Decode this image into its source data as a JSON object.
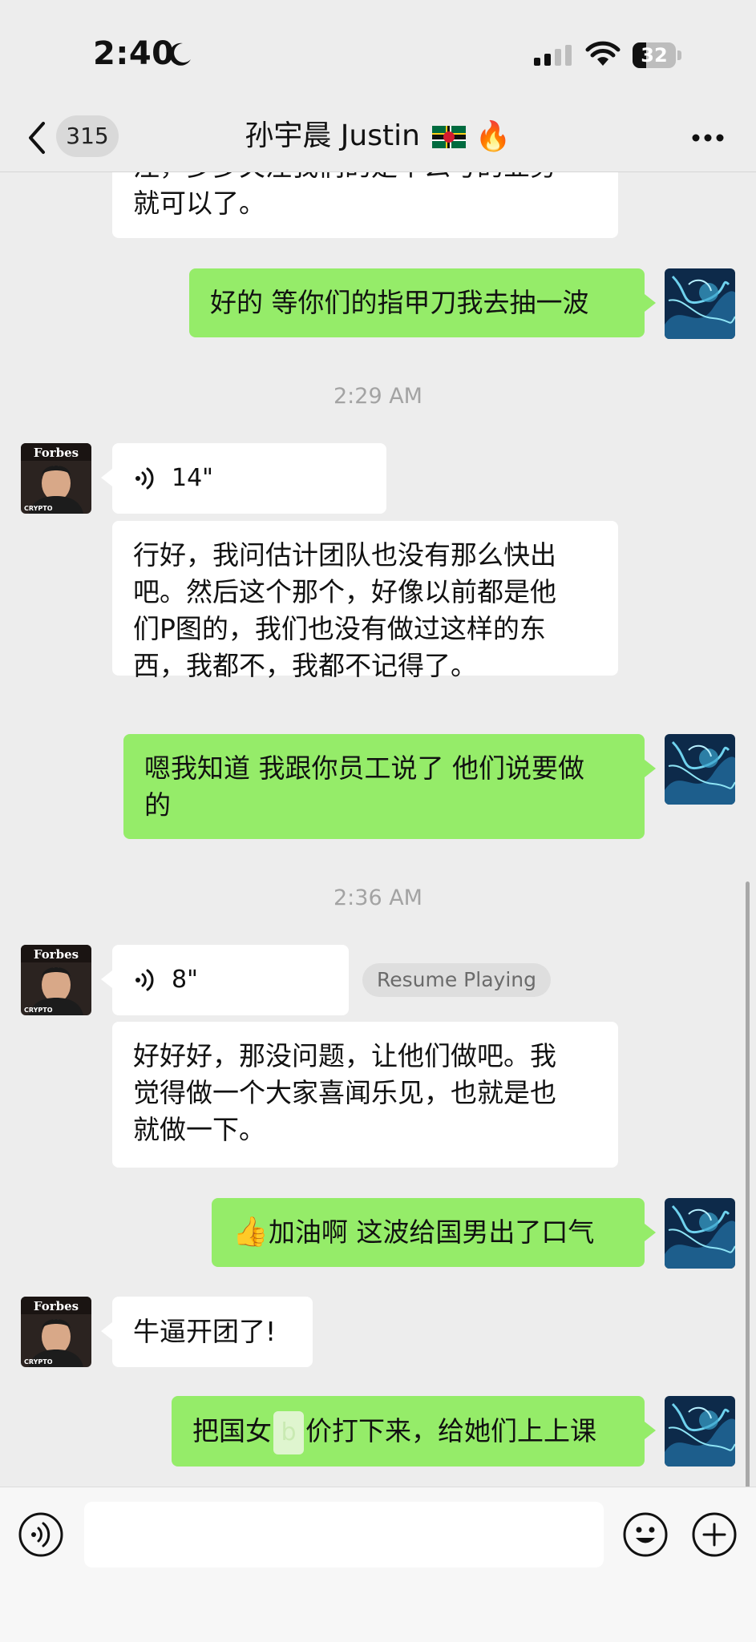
{
  "status_bar": {
    "time": "2:40",
    "battery": "32",
    "battery_level_percent": 32
  },
  "header": {
    "unread_count": "315",
    "title": "孙宇晨 Justin"
  },
  "messages": {
    "m0_line1": "注，多多关注我们的是个么号的业务",
    "m0_line2": "就可以了。",
    "m1": "好的 等你们的指甲刀我去抽一波",
    "ts1": "2:29 AM",
    "voice1": "14\"",
    "m2_line1": "行好，我问估计团队也没有那么快出",
    "m2_line2": "吧。然后这个那个，好像以前都是他",
    "m2_line3": "们P图的，我们也没有做过这样的东",
    "m2_line4": "西，我都不，我都不记得了。",
    "m3_line1": "嗯我知道 我跟你员工说了 他们说要做",
    "m3_line2": "的",
    "ts2": "2:36 AM",
    "voice2": "8\"",
    "resume": "Resume Playing",
    "m4_line1": "好好好，那没问题，让他们做吧。我",
    "m4_line2": "觉得做一个大家喜闻乐见，也就是也",
    "m4_line3": "就做一下。",
    "m5": "加油啊 这波给国男出了口气",
    "m6": "牛逼开团了!",
    "m7_a": "把国女",
    "m7_caret": "b",
    "m7_b": "价打下来，给她们上上课"
  },
  "avatars": {
    "contact_label": "Forbes",
    "contact_sub": "CRYPTO"
  },
  "icons": {
    "back": "chevron-left-icon",
    "more": "more-dots-icon",
    "voice": "voice-wave-icon",
    "emoji": "smiley-icon",
    "plus": "plus-circle-icon",
    "flag": "dominica-flag-icon",
    "fire": "fire-icon"
  },
  "colors": {
    "bg": "#ededed",
    "out_bubble": "#95ec69",
    "in_bubble": "#ffffff"
  }
}
